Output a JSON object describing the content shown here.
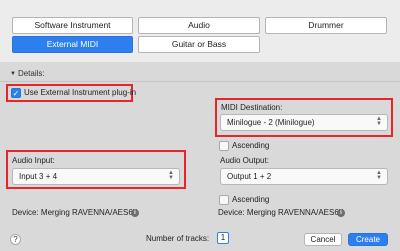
{
  "track_types": [
    {
      "label": "Software Instrument",
      "selected": false
    },
    {
      "label": "Audio",
      "selected": false
    },
    {
      "label": "Drummer",
      "selected": false
    },
    {
      "label": "External MIDI",
      "selected": true
    },
    {
      "label": "Guitar or Bass",
      "selected": false
    }
  ],
  "details": {
    "label": "Details:"
  },
  "use_external_plugin": {
    "label": "Use External Instrument plug-in",
    "checked": true
  },
  "midi_destination": {
    "label": "MIDI Destination:",
    "value": "Minilogue - 2 (Minilogue)"
  },
  "ascending_1": {
    "label": "Ascending",
    "checked": false
  },
  "audio_input": {
    "label": "Audio Input:",
    "value": "Input 3 + 4"
  },
  "audio_output": {
    "label": "Audio Output:",
    "value": "Output 1 + 2"
  },
  "ascending_2": {
    "label": "Ascending",
    "checked": false
  },
  "device_left": {
    "label": "Device: Merging RAVENNA/AES67"
  },
  "device_right": {
    "label": "Device: Merging RAVENNA/AES67"
  },
  "footer": {
    "help": "?",
    "tracks_label": "Number of tracks:",
    "tracks_value": "1",
    "cancel": "Cancel",
    "create": "Create"
  },
  "colors": {
    "accent": "#2d7ff0",
    "highlight": "#e8252b"
  }
}
